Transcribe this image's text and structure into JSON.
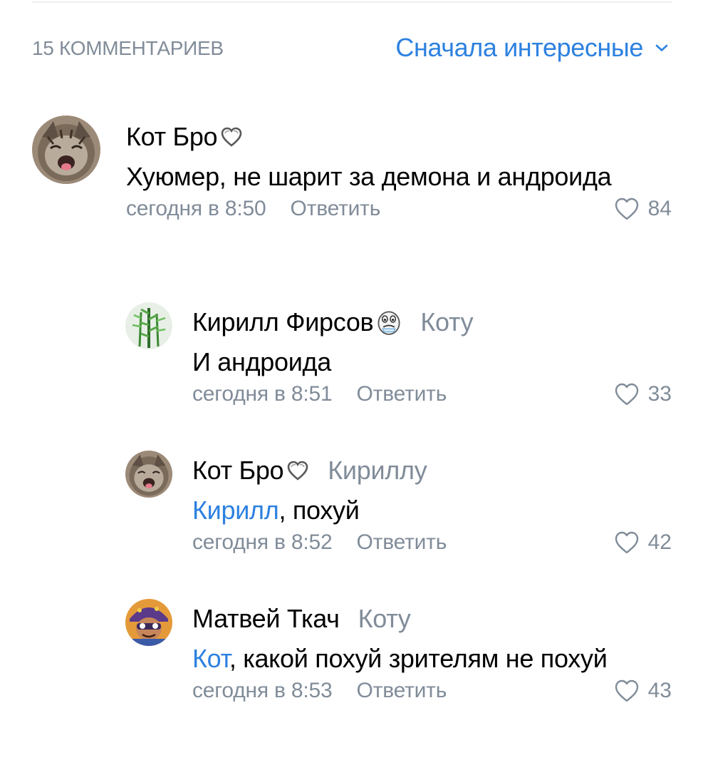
{
  "header": {
    "count_label": "15 КОММЕНТАРИЕВ",
    "sort_label": "Сначала интересные"
  },
  "colors": {
    "accent": "#2d81e0",
    "secondary_text": "#818c99",
    "primary_text": "#000000"
  },
  "comments": [
    {
      "author": "Кот Бро",
      "badge_icon": "heart-outline-badge-icon",
      "reply_to": "",
      "mention": "",
      "text": "Хуюмер, не шарит за демона и андроида",
      "time": "сегодня в 8:50",
      "reply_label": "Ответить",
      "likes": "84",
      "avatar_icon": "cat-avatar-icon"
    },
    {
      "author": "Кирилл Фирсов",
      "badge_icon": "crying-face-badge-icon",
      "reply_to": "Коту",
      "mention": "",
      "text": "И андроида",
      "time": "сегодня в 8:51",
      "reply_label": "Ответить",
      "likes": "33",
      "avatar_icon": "plant-avatar-icon"
    },
    {
      "author": "Кот Бро",
      "badge_icon": "heart-outline-badge-icon",
      "reply_to": "Кириллу",
      "mention": "Кирилл",
      "text": ", похуй",
      "time": "сегодня в 8:52",
      "reply_label": "Ответить",
      "likes": "42",
      "avatar_icon": "cat-avatar-icon"
    },
    {
      "author": "Матвей Ткач",
      "badge_icon": "",
      "reply_to": "Коту",
      "mention": "Кот",
      "text": ", какой похуй зрителям не похуй",
      "time": "сегодня в 8:53",
      "reply_label": "Ответить",
      "likes": "43",
      "avatar_icon": "cartoon-avatar-icon"
    }
  ]
}
